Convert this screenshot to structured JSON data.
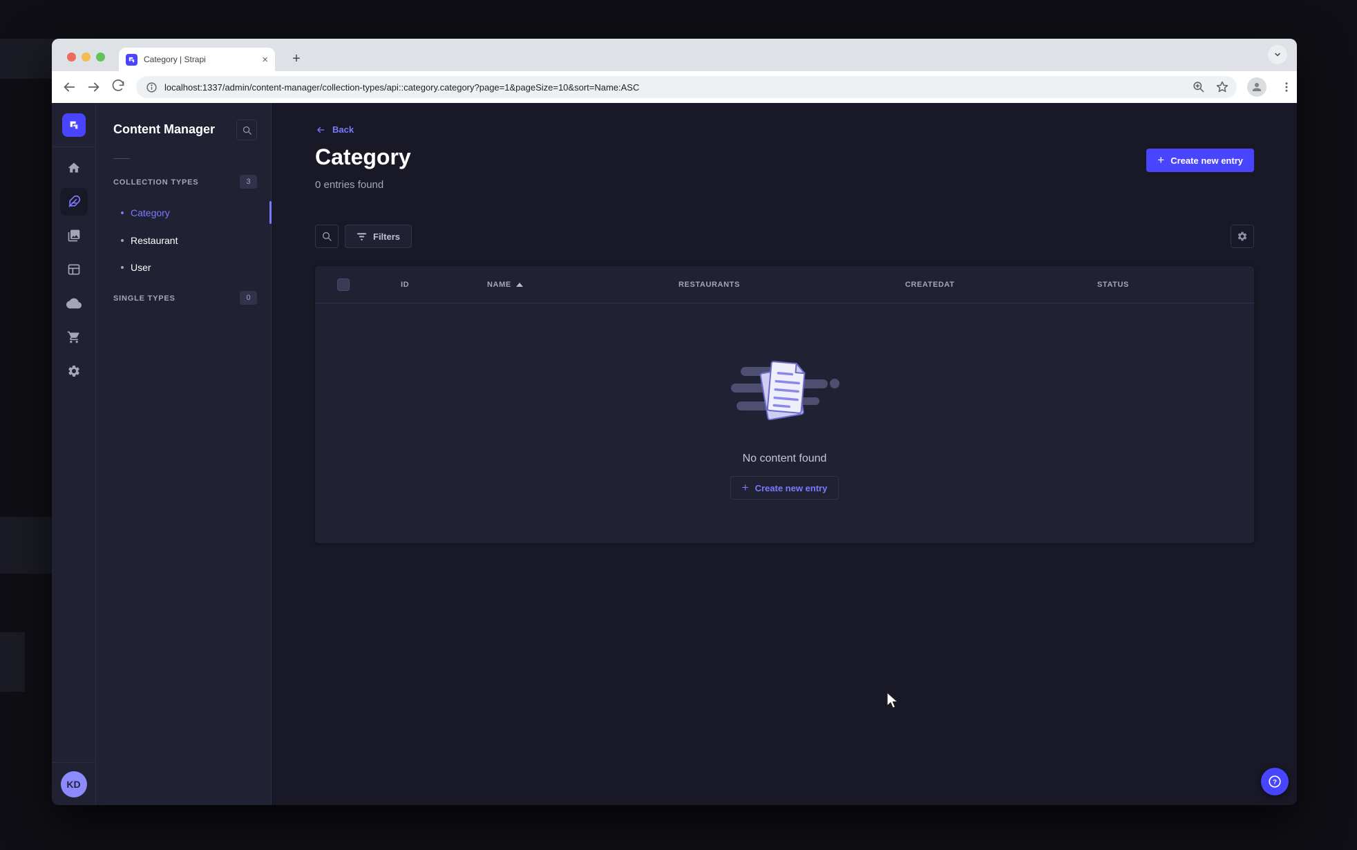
{
  "browser": {
    "tab": {
      "title": "Category | Strapi",
      "close_label": "×",
      "favicon": "strapi-logo"
    },
    "new_tab_label": "+",
    "url": "localhost:1337/admin/content-manager/collection-types/api::category.category?page=1&pageSize=10&sort=Name:ASC",
    "icons": [
      "back-arrow",
      "forward-arrow",
      "reload",
      "site-info",
      "zoom-search",
      "bookmark-star",
      "profile",
      "menu-dots",
      "tab-search-chevron"
    ]
  },
  "sidebar": {
    "icons": [
      {
        "name": "strapi-logo",
        "active": false
      },
      {
        "name": "home",
        "active": false
      },
      {
        "name": "content-manager-feather",
        "active": true
      },
      {
        "name": "media-library",
        "active": false
      },
      {
        "name": "content-type-builder",
        "active": false
      },
      {
        "name": "deploy-cloud",
        "active": false
      },
      {
        "name": "marketplace-cart",
        "active": false
      },
      {
        "name": "settings-gear",
        "active": false
      }
    ],
    "avatar_initials": "KD"
  },
  "subnav": {
    "title": "Content Manager",
    "search_icon": "search",
    "sections": [
      {
        "label": "COLLECTION TYPES",
        "badge": "3",
        "items": [
          {
            "label": "Category",
            "active": true
          },
          {
            "label": "Restaurant",
            "active": false
          },
          {
            "label": "User",
            "active": false
          }
        ]
      },
      {
        "label": "SINGLE TYPES",
        "badge": "0",
        "items": []
      }
    ]
  },
  "main": {
    "back_label": "Back",
    "title": "Category",
    "subtitle": "0 entries found",
    "create_button_label": "Create new entry",
    "filters_button_label": "Filters",
    "table": {
      "columns": [
        "ID",
        "NAME",
        "RESTAURANTS",
        "CREATEDAT",
        "STATUS"
      ],
      "sorted_column": "NAME",
      "sort_direction": "ASC"
    },
    "empty_state": {
      "message": "No content found",
      "create_button_label": "Create new entry"
    }
  },
  "colors": {
    "primary": "#4945ff",
    "primary_light": "#7b79ff",
    "page_bg": "#181826",
    "panel_bg": "#212134",
    "border": "#32324d",
    "text_muted": "#a5a5ba",
    "avatar_bg": "#8c8aff"
  }
}
